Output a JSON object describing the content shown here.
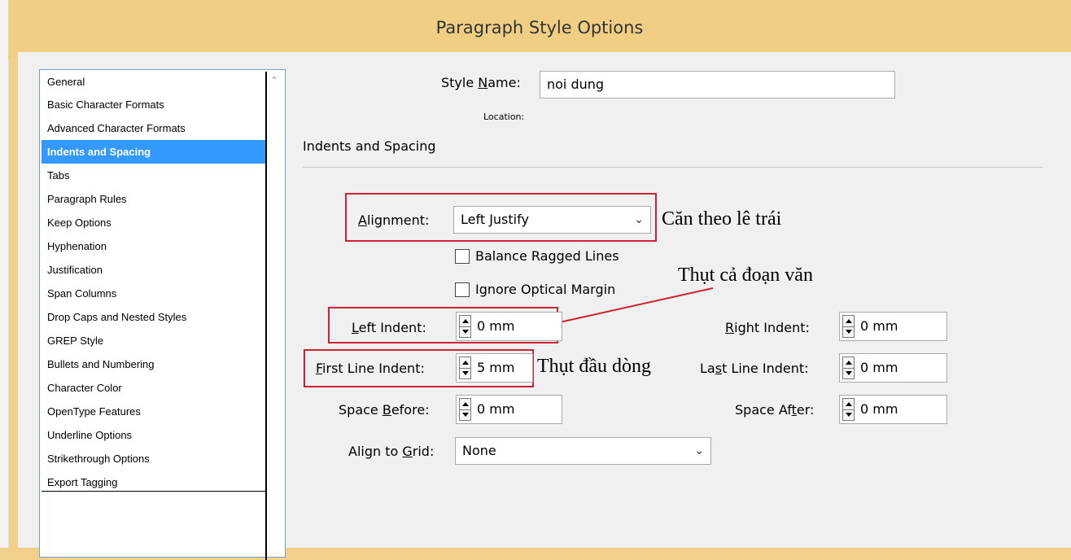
{
  "window": {
    "title": "Paragraph Style Options"
  },
  "sidebar": {
    "items": [
      "General",
      "Basic Character Formats",
      "Advanced Character Formats",
      "Indents and Spacing",
      "Tabs",
      "Paragraph Rules",
      "Keep Options",
      "Hyphenation",
      "Justification",
      "Span Columns",
      "Drop Caps and Nested Styles",
      "GREP Style",
      "Bullets and Numbering",
      "Character Color",
      "OpenType Features",
      "Underline Options",
      "Strikethrough Options",
      "Export Tagging"
    ],
    "selected": "Indents and Spacing"
  },
  "form": {
    "style_name_label_pre": "Style ",
    "style_name_label_u": "N",
    "style_name_label_post": "ame:",
    "style_name_value": "noi dung",
    "location_label": "Location:",
    "section_title": "Indents and Spacing",
    "alignment_label_u": "A",
    "alignment_label_post": "lignment:",
    "alignment_value": "Left Justify",
    "balance_ragged": "Balance Ragged Lines",
    "ignore_optical": "Ignore Optical Margin",
    "left_indent_label_u": "L",
    "left_indent_label_post": "eft Indent:",
    "left_indent_value": "0 mm",
    "right_indent_label_u": "R",
    "right_indent_label_post": "ight Indent:",
    "right_indent_value": "0 mm",
    "first_line_label_u": "F",
    "first_line_label_post": "irst Line Indent:",
    "first_line_value": "5 mm",
    "last_line_label_pre": "La",
    "last_line_label_u": "s",
    "last_line_label_post": "t Line Indent:",
    "last_line_value": "0 mm",
    "space_before_label_pre": "Space ",
    "space_before_label_u": "B",
    "space_before_label_post": "efore:",
    "space_before_value": "0 mm",
    "space_after_label_pre": "Space Af",
    "space_after_label_u": "t",
    "space_after_label_post": "er:",
    "space_after_value": "0 mm",
    "align_grid_label_pre": "Align to ",
    "align_grid_label_u": "G",
    "align_grid_label_post": "rid:",
    "align_grid_value": "None"
  },
  "annotations": {
    "alignment_note": "Căn theo lê trái",
    "left_indent_note": "Thụt cả đoạn văn",
    "first_line_note": "Thụt đầu dòng"
  },
  "colors": {
    "accent_red": "#cc2233",
    "selection": "#3399ff"
  }
}
